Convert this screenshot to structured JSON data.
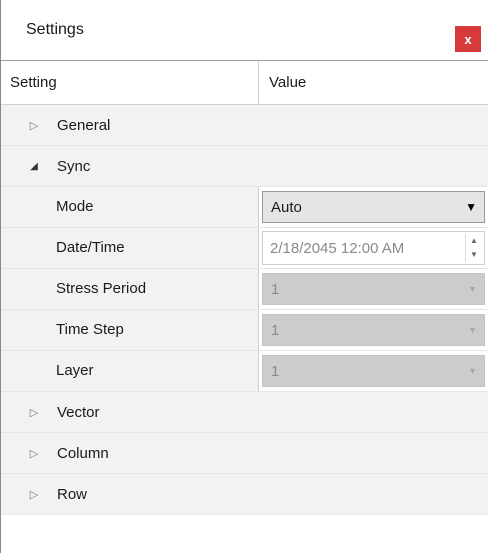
{
  "window": {
    "title": "Settings",
    "close_label": "x"
  },
  "columns": {
    "setting": "Setting",
    "value": "Value"
  },
  "categories": {
    "general": {
      "label": "General",
      "expanded": false
    },
    "sync": {
      "label": "Sync",
      "expanded": true
    },
    "vector": {
      "label": "Vector",
      "expanded": false
    },
    "column": {
      "label": "Column",
      "expanded": false
    },
    "row": {
      "label": "Row",
      "expanded": false
    }
  },
  "sync_props": {
    "mode": {
      "label": "Mode",
      "value": "Auto"
    },
    "datetime": {
      "label": "Date/Time",
      "value": "2/18/2045 12:00 AM"
    },
    "stress_period": {
      "label": "Stress Period",
      "value": "1"
    },
    "time_step": {
      "label": "Time Step",
      "value": "1"
    },
    "layer": {
      "label": "Layer",
      "value": "1"
    }
  },
  "icons": {
    "collapsed": "chevron-right-icon",
    "expanded": "triangle-down-icon",
    "dropdown": "caret-down-icon",
    "spin_up": "spin-up-icon",
    "spin_down": "spin-down-icon"
  },
  "colors": {
    "close_button": "#d63a3a",
    "category_bg": "#f2f2f2",
    "disabled_bg": "#cccccc"
  }
}
